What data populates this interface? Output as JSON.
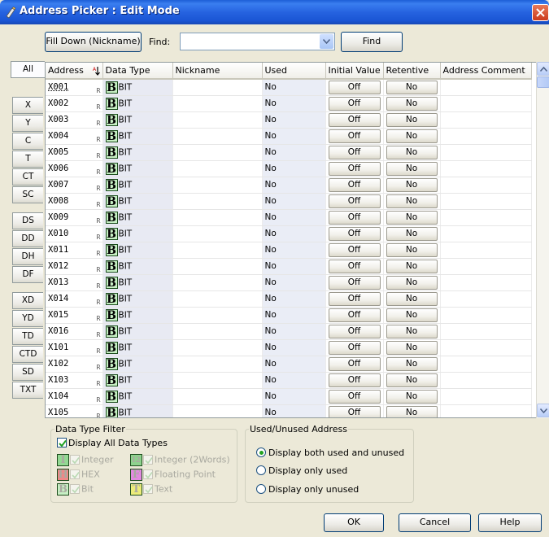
{
  "window": {
    "title": "Address Picker : Edit Mode"
  },
  "toolbar": {
    "fill_down_label": "Fill Down (Nickname)",
    "find_label": "Find:",
    "find_value": "",
    "find_button": "Find"
  },
  "tabs": [
    "All",
    "X",
    "Y",
    "C",
    "T",
    "CT",
    "SC",
    "DS",
    "DD",
    "DH",
    "DF",
    "XD",
    "YD",
    "TD",
    "CTD",
    "SD",
    "TXT"
  ],
  "active_tab": "All",
  "grid": {
    "columns": [
      "Address",
      "Data Type",
      "Nickname",
      "Used",
      "Initial Value",
      "Retentive",
      "Address Comment"
    ],
    "sort_column": "Address",
    "retentive_marker": "R",
    "type_icon_letter": "B",
    "rows": [
      {
        "address": "X001",
        "type": "BIT",
        "nickname": "",
        "used": "No",
        "initial": "Off",
        "retentive": "No",
        "comment": ""
      },
      {
        "address": "X002",
        "type": "BIT",
        "nickname": "",
        "used": "No",
        "initial": "Off",
        "retentive": "No",
        "comment": ""
      },
      {
        "address": "X003",
        "type": "BIT",
        "nickname": "",
        "used": "No",
        "initial": "Off",
        "retentive": "No",
        "comment": ""
      },
      {
        "address": "X004",
        "type": "BIT",
        "nickname": "",
        "used": "No",
        "initial": "Off",
        "retentive": "No",
        "comment": ""
      },
      {
        "address": "X005",
        "type": "BIT",
        "nickname": "",
        "used": "No",
        "initial": "Off",
        "retentive": "No",
        "comment": ""
      },
      {
        "address": "X006",
        "type": "BIT",
        "nickname": "",
        "used": "No",
        "initial": "Off",
        "retentive": "No",
        "comment": ""
      },
      {
        "address": "X007",
        "type": "BIT",
        "nickname": "",
        "used": "No",
        "initial": "Off",
        "retentive": "No",
        "comment": ""
      },
      {
        "address": "X008",
        "type": "BIT",
        "nickname": "",
        "used": "No",
        "initial": "Off",
        "retentive": "No",
        "comment": ""
      },
      {
        "address": "X009",
        "type": "BIT",
        "nickname": "",
        "used": "No",
        "initial": "Off",
        "retentive": "No",
        "comment": ""
      },
      {
        "address": "X010",
        "type": "BIT",
        "nickname": "",
        "used": "No",
        "initial": "Off",
        "retentive": "No",
        "comment": ""
      },
      {
        "address": "X011",
        "type": "BIT",
        "nickname": "",
        "used": "No",
        "initial": "Off",
        "retentive": "No",
        "comment": ""
      },
      {
        "address": "X012",
        "type": "BIT",
        "nickname": "",
        "used": "No",
        "initial": "Off",
        "retentive": "No",
        "comment": ""
      },
      {
        "address": "X013",
        "type": "BIT",
        "nickname": "",
        "used": "No",
        "initial": "Off",
        "retentive": "No",
        "comment": ""
      },
      {
        "address": "X014",
        "type": "BIT",
        "nickname": "",
        "used": "No",
        "initial": "Off",
        "retentive": "No",
        "comment": ""
      },
      {
        "address": "X015",
        "type": "BIT",
        "nickname": "",
        "used": "No",
        "initial": "Off",
        "retentive": "No",
        "comment": ""
      },
      {
        "address": "X016",
        "type": "BIT",
        "nickname": "",
        "used": "No",
        "initial": "Off",
        "retentive": "No",
        "comment": ""
      },
      {
        "address": "X101",
        "type": "BIT",
        "nickname": "",
        "used": "No",
        "initial": "Off",
        "retentive": "No",
        "comment": ""
      },
      {
        "address": "X102",
        "type": "BIT",
        "nickname": "",
        "used": "No",
        "initial": "Off",
        "retentive": "No",
        "comment": ""
      },
      {
        "address": "X103",
        "type": "BIT",
        "nickname": "",
        "used": "No",
        "initial": "Off",
        "retentive": "No",
        "comment": ""
      },
      {
        "address": "X104",
        "type": "BIT",
        "nickname": "",
        "used": "No",
        "initial": "Off",
        "retentive": "No",
        "comment": ""
      },
      {
        "address": "X105",
        "type": "BIT",
        "nickname": "",
        "used": "No",
        "initial": "Off",
        "retentive": "No",
        "comment": ""
      }
    ]
  },
  "data_type_filter": {
    "legend": "Data Type Filter",
    "display_all": {
      "label": "Display All Data Types",
      "checked": true
    },
    "types": [
      {
        "icon": "I",
        "label": "Integer",
        "checked": true
      },
      {
        "icon": "I2",
        "label": "Integer (2Words)",
        "checked": true
      },
      {
        "icon": "H",
        "label": "HEX",
        "checked": true
      },
      {
        "icon": "F",
        "label": "Floating Point",
        "checked": true
      },
      {
        "icon": "B",
        "label": "Bit",
        "checked": true
      },
      {
        "icon": "T",
        "label": "Text",
        "checked": true
      }
    ]
  },
  "used_filter": {
    "legend": "Used/Unused Address",
    "options": [
      {
        "label": "Display both used and unused",
        "selected": true
      },
      {
        "label": "Display only used",
        "selected": false
      },
      {
        "label": "Display only unused",
        "selected": false
      }
    ]
  },
  "buttons": {
    "ok": "OK",
    "cancel": "Cancel",
    "help": "Help"
  },
  "colors": {
    "title_bar": "#2663e0",
    "dialog_bg": "#ece9d8",
    "bit_icon": "#c7efc4",
    "radio_dot": "#21a121"
  }
}
